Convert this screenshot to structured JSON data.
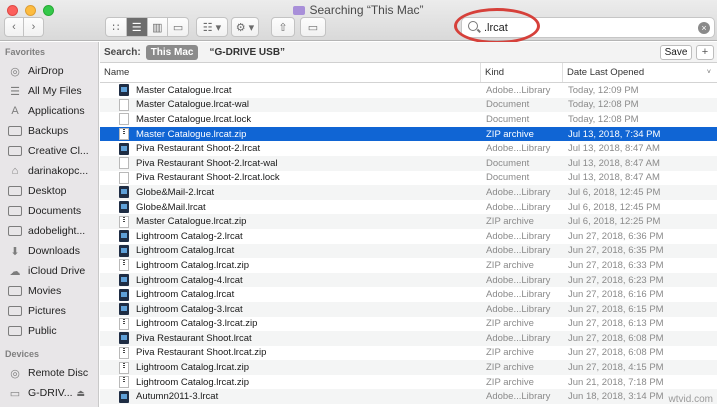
{
  "window": {
    "title": "Searching “This Mac”"
  },
  "toolbar": {
    "back_glyph": "‹",
    "forward_glyph": "›",
    "view_icons": [
      "∷",
      "☰",
      "▥",
      "▭"
    ],
    "arrange_glyph": "☷ ▾",
    "action_glyph": "⚙ ▾",
    "share_glyph": "⇧",
    "tag_glyph": "▭"
  },
  "search": {
    "value": ".lrcat",
    "placeholder": "Search",
    "clear_glyph": "×"
  },
  "sidebar": {
    "favorites_header": "Favorites",
    "favorites": [
      {
        "label": "AirDrop",
        "icon": "airdrop-icon",
        "glyph": "◎"
      },
      {
        "label": "All My Files",
        "icon": "all-files-icon",
        "glyph": "☰"
      },
      {
        "label": "Applications",
        "icon": "applications-icon",
        "glyph": "A"
      },
      {
        "label": "Backups",
        "icon": "folder-icon",
        "glyph": ""
      },
      {
        "label": "Creative Cl...",
        "icon": "folder-icon",
        "glyph": ""
      },
      {
        "label": "darinakopc...",
        "icon": "home-icon",
        "glyph": "⌂"
      },
      {
        "label": "Desktop",
        "icon": "desktop-icon",
        "glyph": ""
      },
      {
        "label": "Documents",
        "icon": "documents-icon",
        "glyph": ""
      },
      {
        "label": "adobelight...",
        "icon": "folder-icon",
        "glyph": ""
      },
      {
        "label": "Downloads",
        "icon": "downloads-icon",
        "glyph": "⬇"
      },
      {
        "label": "iCloud Drive",
        "icon": "cloud-icon",
        "glyph": "☁"
      },
      {
        "label": "Movies",
        "icon": "movies-icon",
        "glyph": ""
      },
      {
        "label": "Pictures",
        "icon": "pictures-icon",
        "glyph": ""
      },
      {
        "label": "Public",
        "icon": "public-icon",
        "glyph": ""
      }
    ],
    "devices_header": "Devices",
    "devices": [
      {
        "label": "Remote Disc",
        "icon": "disc-icon",
        "glyph": "◎"
      },
      {
        "label": "G-DRIV...",
        "icon": "drive-icon",
        "glyph": "▭",
        "eject": "⏏"
      }
    ]
  },
  "scope": {
    "label": "Search:",
    "active": "This Mac",
    "other": "“G-DRIVE USB”",
    "save_label": "Save",
    "plus_label": "+"
  },
  "columns": {
    "name": "Name",
    "kind": "Kind",
    "date": "Date Last Opened",
    "sort_caret": "˅"
  },
  "files": [
    {
      "name": "Master Catalogue.lrcat",
      "type": "lrcat",
      "kind": "Adobe...Library",
      "date": "Today, 12:09 PM"
    },
    {
      "name": "Master Catalogue.lrcat-wal",
      "type": "doc",
      "kind": "Document",
      "date": "Today, 12:08 PM"
    },
    {
      "name": "Master Catalogue.lrcat.lock",
      "type": "doc",
      "kind": "Document",
      "date": "Today, 12:08 PM"
    },
    {
      "name": "Master Catalogue.lrcat.zip",
      "type": "zip",
      "kind": "ZIP archive",
      "date": "Jul 13, 2018, 7:34 PM",
      "selected": true
    },
    {
      "name": "Piva Restaurant Shoot-2.lrcat",
      "type": "lrcat",
      "kind": "Adobe...Library",
      "date": "Jul 13, 2018, 8:47 AM"
    },
    {
      "name": "Piva Restaurant Shoot-2.lrcat-wal",
      "type": "doc",
      "kind": "Document",
      "date": "Jul 13, 2018, 8:47 AM"
    },
    {
      "name": "Piva Restaurant Shoot-2.lrcat.lock",
      "type": "doc",
      "kind": "Document",
      "date": "Jul 13, 2018, 8:47 AM"
    },
    {
      "name": "Globe&Mail-2.lrcat",
      "type": "lrcat",
      "kind": "Adobe...Library",
      "date": "Jul 6, 2018, 12:45 PM"
    },
    {
      "name": "Globe&Mail.lrcat",
      "type": "lrcat",
      "kind": "Adobe...Library",
      "date": "Jul 6, 2018, 12:45 PM"
    },
    {
      "name": "Master Catalogue.lrcat.zip",
      "type": "zip",
      "kind": "ZIP archive",
      "date": "Jul 6, 2018, 12:25 PM"
    },
    {
      "name": "Lightroom Catalog-2.lrcat",
      "type": "lrcat",
      "kind": "Adobe...Library",
      "date": "Jun 27, 2018, 6:36 PM"
    },
    {
      "name": "Lightroom Catalog.lrcat",
      "type": "lrcat",
      "kind": "Adobe...Library",
      "date": "Jun 27, 2018, 6:35 PM"
    },
    {
      "name": "Lightroom Catalog.lrcat.zip",
      "type": "zip",
      "kind": "ZIP archive",
      "date": "Jun 27, 2018, 6:33 PM"
    },
    {
      "name": "Lightroom Catalog-4.lrcat",
      "type": "lrcat",
      "kind": "Adobe...Library",
      "date": "Jun 27, 2018, 6:23 PM"
    },
    {
      "name": "Lightroom Catalog.lrcat",
      "type": "lrcat",
      "kind": "Adobe...Library",
      "date": "Jun 27, 2018, 6:16 PM"
    },
    {
      "name": "Lightroom Catalog-3.lrcat",
      "type": "lrcat",
      "kind": "Adobe...Library",
      "date": "Jun 27, 2018, 6:15 PM"
    },
    {
      "name": "Lightroom Catalog-3.lrcat.zip",
      "type": "zip",
      "kind": "ZIP archive",
      "date": "Jun 27, 2018, 6:13 PM"
    },
    {
      "name": "Piva Restaurant Shoot.lrcat",
      "type": "lrcat",
      "kind": "Adobe...Library",
      "date": "Jun 27, 2018, 6:08 PM"
    },
    {
      "name": "Piva Restaurant Shoot.lrcat.zip",
      "type": "zip",
      "kind": "ZIP archive",
      "date": "Jun 27, 2018, 6:08 PM"
    },
    {
      "name": "Lightroom Catalog.lrcat.zip",
      "type": "zip",
      "kind": "ZIP archive",
      "date": "Jun 27, 2018, 4:15 PM"
    },
    {
      "name": "Lightroom Catalog.lrcat.zip",
      "type": "zip",
      "kind": "ZIP archive",
      "date": "Jun 21, 2018, 7:18 PM"
    },
    {
      "name": "Autumn2011-3.lrcat",
      "type": "lrcat",
      "kind": "Adobe...Library",
      "date": "Jun 18, 2018, 3:14 PM"
    }
  ],
  "watermark": "wtvid.com",
  "colors": {
    "selection": "#1065d4",
    "highlight_ring": "#d6403a",
    "sidebar_bg": "#e8e6e8"
  }
}
